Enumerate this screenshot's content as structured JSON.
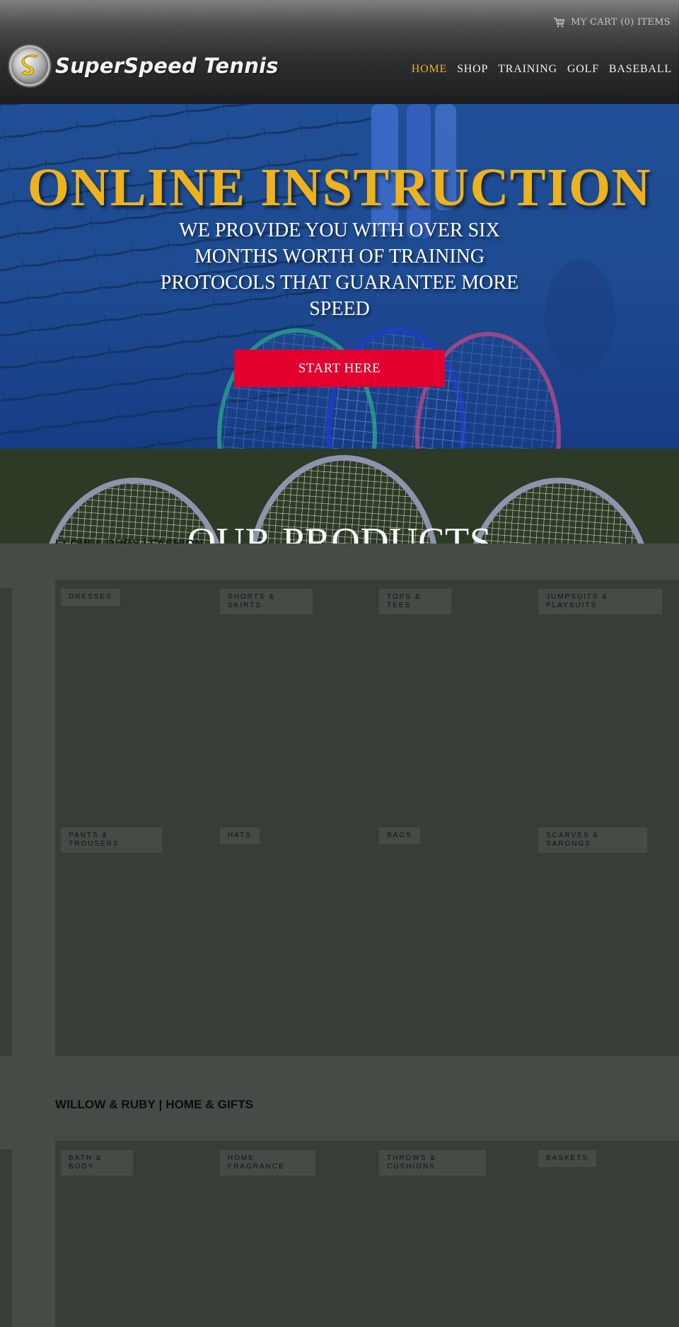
{
  "header": {
    "brand": "SuperSpeed Tennis",
    "logo_icon": "s-badge-icon",
    "cart_icon": "cart-icon",
    "cart_label": "MY CART (0) ITEMS",
    "nav": [
      {
        "label": "HOME",
        "active": true
      },
      {
        "label": "SHOP",
        "active": false
      },
      {
        "label": "TRAINING",
        "active": false
      },
      {
        "label": "GOLF",
        "active": false
      },
      {
        "label": "BASEBALL",
        "active": false
      }
    ],
    "colors": {
      "active_nav": "#e7b234",
      "nav_text": "#f2f2f2"
    }
  },
  "hero": {
    "title": "ONLINE INSTRUCTION",
    "subtitle": "WE PROVIDE YOU WITH OVER SIX MONTHS WORTH OF TRAINING PROTOCOLS THAT GUARANTEE MORE SPEED",
    "cta_label": "START HERE",
    "colors": {
      "title": "#edb21d",
      "cta_bg": "#e4002e",
      "overlay": "#1f4f96"
    }
  },
  "products_banner": {
    "title": "OUR PRODUCTS"
  },
  "sections": [
    {
      "title": "WILLOW & RUBY | FASHION",
      "title_partial_visible": "LLOW & RUBY | FASHION",
      "categories": [
        "DRESSES",
        "SHORTS & SKIRTS",
        "TOPS & TEES",
        "JUMPSUITS & PLAYSUITS",
        "PANTS & TROUSERS",
        "HATS",
        "BAGS",
        "SCARVES & SARONGS"
      ]
    },
    {
      "title": "WILLOW & RUBY | HOME & GIFTS",
      "categories": [
        "BATH & BODY",
        "HOME FRAGRANCE",
        "THROWS & CUSHIONS",
        "BASKETS"
      ]
    }
  ]
}
